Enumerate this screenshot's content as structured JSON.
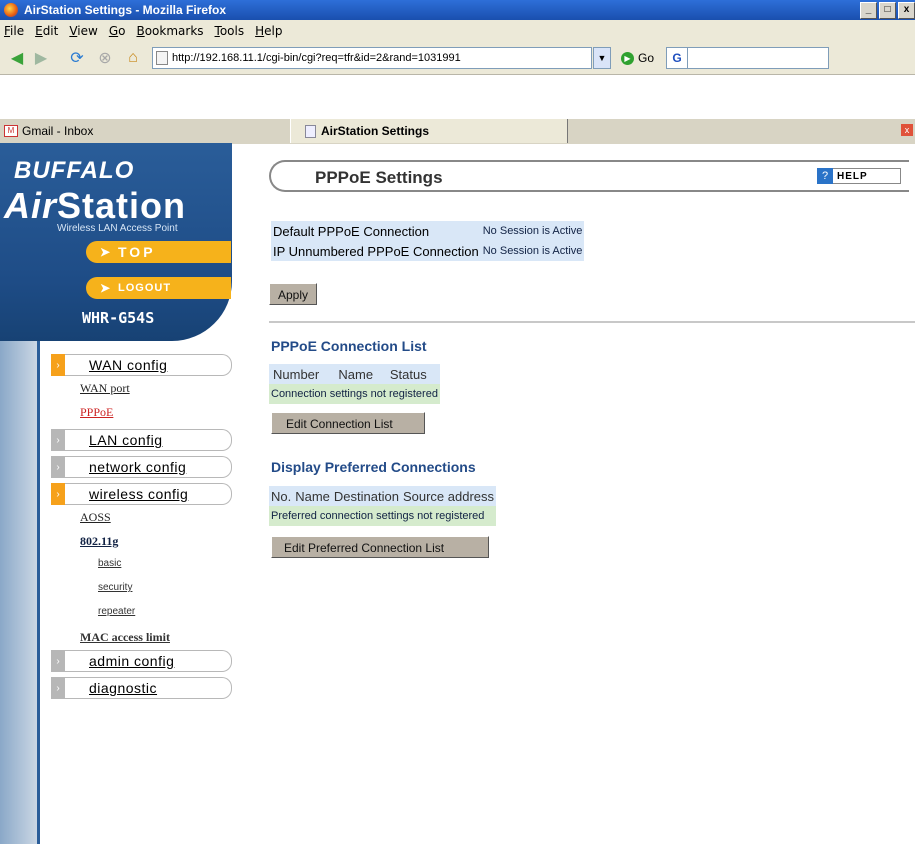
{
  "window": {
    "title": "AirStation Settings - Mozilla Firefox",
    "controls": [
      "_",
      "□",
      "x"
    ]
  },
  "menubar": [
    "File",
    "Edit",
    "View",
    "Go",
    "Bookmarks",
    "Tools",
    "Help"
  ],
  "toolbar": {
    "url": "http://192.168.11.1/cgi-bin/cgi?req=tfr&id=2&rand=1031991",
    "go_label": "Go",
    "google_label": "G"
  },
  "tabs": [
    {
      "label": "Gmail - Inbox",
      "active": false
    },
    {
      "label": "AirStation Settings",
      "active": true
    }
  ],
  "sidebar": {
    "brand": "BUFFALO",
    "product_air": "Air",
    "product_station": "Station",
    "subtitle": "Wireless LAN Access Point",
    "top_label": "TOP",
    "logout_label": "LOGOUT",
    "model": "WHR-G54S",
    "menu": {
      "wan": "WAN config",
      "wan_port": "WAN port",
      "pppoe": "PPPoE",
      "lan": "LAN config",
      "network": "network config",
      "wireless": "wireless config",
      "aoss": "AOSS",
      "dot11g": "802.11g",
      "basic": "basic",
      "security": "security",
      "repeater": "repeater",
      "mac": "MAC access limit",
      "admin": "admin config",
      "diagnostic": "diagnostic"
    }
  },
  "main": {
    "title": "PPPoE Settings",
    "help_label": "HELP",
    "status_rows": [
      {
        "label": "Default PPPoE Connection",
        "value": "No Session is Active"
      },
      {
        "label": "IP Unnumbered PPPoE Connection",
        "value": "No Session is Active"
      }
    ],
    "apply_label": "Apply",
    "conn_list": {
      "title": "PPPoE Connection List",
      "headers": [
        "Number",
        "Name",
        "Status"
      ],
      "empty": "Connection settings not registered",
      "button": "Edit Connection List"
    },
    "preferred": {
      "title": "Display Preferred Connections",
      "headers": [
        "No.",
        "Name",
        "Destination",
        "Source address"
      ],
      "empty": "Preferred connection settings not registered",
      "button": "Edit Preferred Connection List"
    }
  }
}
